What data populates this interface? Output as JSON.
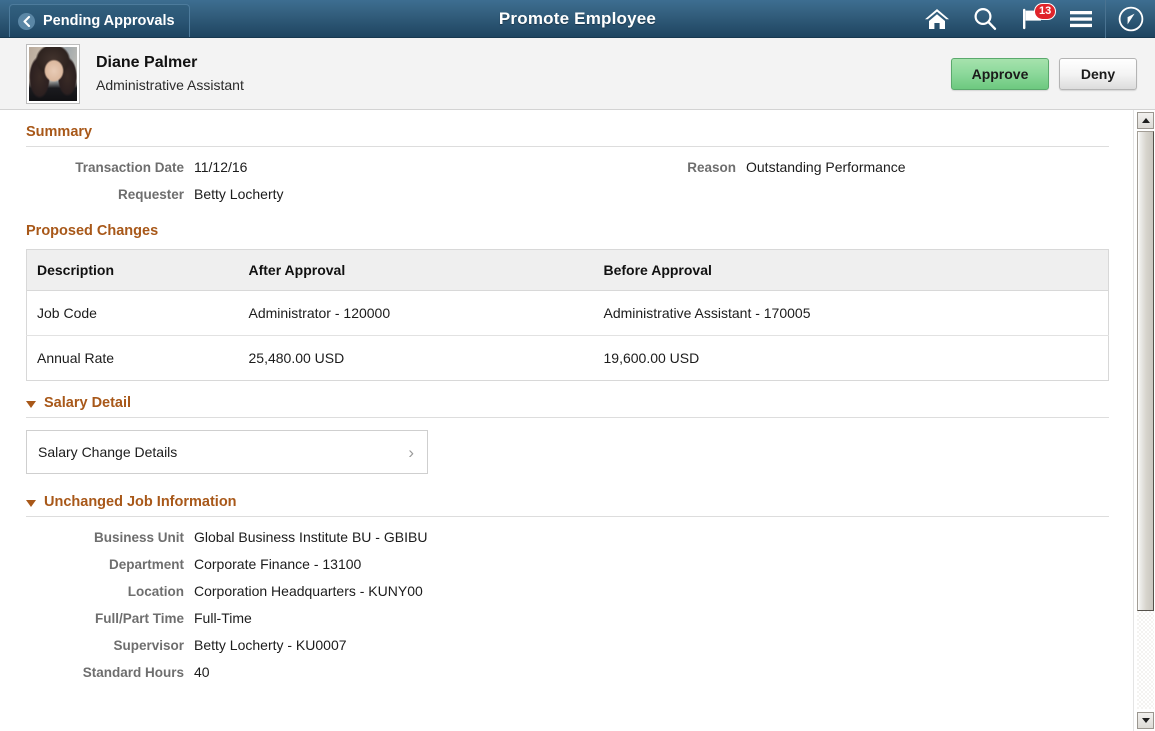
{
  "navbar": {
    "back_label": "Pending Approvals",
    "title": "Promote Employee",
    "icons": [
      {
        "name": "home-icon",
        "label": "Home"
      },
      {
        "name": "search-icon",
        "label": "Search"
      },
      {
        "name": "notifications-flag-icon",
        "label": "Notifications",
        "badge": "13"
      },
      {
        "name": "hamburger-menu-icon",
        "label": "Actions Menu"
      },
      {
        "name": "navbar-compass-icon",
        "label": "NavBar"
      }
    ],
    "badge_count": "13",
    "colors": {
      "bar_top": "#3d6e91",
      "bar_bottom": "#1e4460",
      "badge": "#e0242b"
    }
  },
  "person": {
    "name": "Diane Palmer",
    "job_title": "Administrative Assistant",
    "avatar_alt": "Employee photo"
  },
  "actions": {
    "approve_label": "Approve",
    "deny_label": "Deny",
    "approve_color": "#8bd89a"
  },
  "summary": {
    "heading": "Summary",
    "transaction_date_label": "Transaction Date",
    "transaction_date_value": "11/12/16",
    "requester_label": "Requester",
    "requester_value": "Betty Locherty",
    "reason_label": "Reason",
    "reason_value": "Outstanding Performance"
  },
  "proposed_changes": {
    "heading": "Proposed Changes",
    "columns": [
      "Description",
      "After Approval",
      "Before Approval"
    ],
    "rows": [
      {
        "description": "Job Code",
        "after": "Administrator - 120000",
        "before": "Administrative Assistant - 170005"
      },
      {
        "description": "Annual Rate",
        "after": "25,480.00 USD",
        "before": "19,600.00 USD"
      }
    ]
  },
  "salary_detail": {
    "heading": "Salary Detail",
    "tile_label": "Salary Change Details",
    "tile_chevron": "›"
  },
  "unchanged_job_information": {
    "heading": "Unchanged Job Information",
    "fields": [
      {
        "label": "Business Unit",
        "value": "Global Business Institute BU - GBIBU"
      },
      {
        "label": "Department",
        "value": "Corporate Finance - 13100"
      },
      {
        "label": "Location",
        "value": "Corporation Headquarters - KUNY00"
      },
      {
        "label": "Full/Part Time",
        "value": "Full-Time"
      },
      {
        "label": "Supervisor",
        "value": "Betty Locherty - KU0007"
      },
      {
        "label": "Standard Hours",
        "value": "40"
      }
    ]
  },
  "scrollbar": {
    "up_label": "Scroll up",
    "down_label": "Scroll down"
  },
  "theme": {
    "section_heading_color": "#a85819",
    "label_color": "#6e6e6e",
    "table_header_bg": "#efefef"
  }
}
